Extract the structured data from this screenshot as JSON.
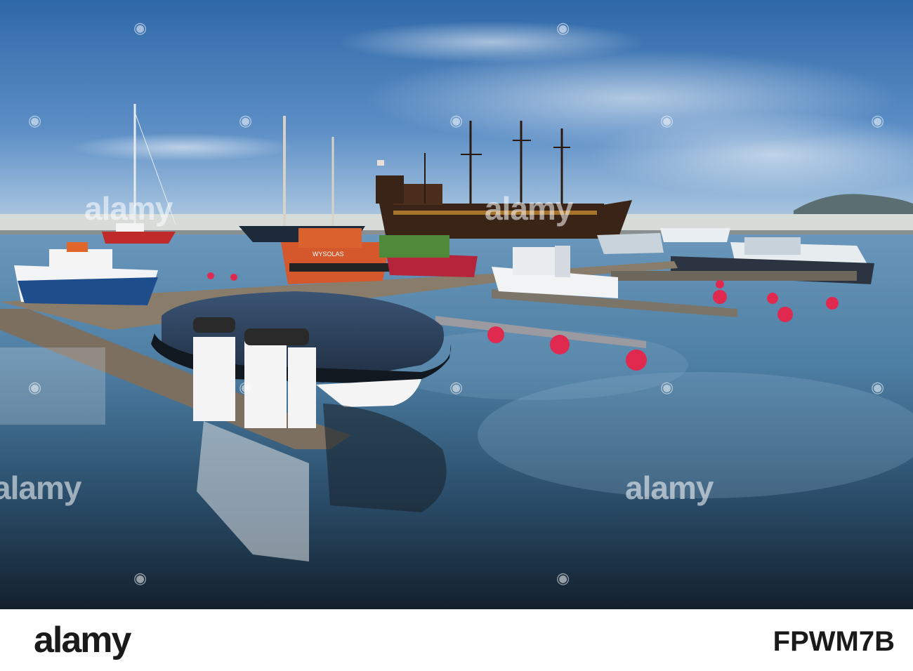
{
  "photo": {
    "description_icon": "marina-photo",
    "colors": {
      "sky_top": "#2f68a8",
      "sky_bottom": "#bcd3e6",
      "water_top": "#5d8fb8",
      "water_bottom": "#13202c",
      "galleon_hull": "#3a2418",
      "orange_boat": "#d5582c",
      "buoy": "#e0294e",
      "cover": "#2c3e58"
    },
    "boat_names": {
      "orange_boat": "WYSOLAS"
    },
    "watermark_text": "alamy"
  },
  "footer": {
    "logo": "alamy",
    "image_id": "FPWM7B"
  }
}
